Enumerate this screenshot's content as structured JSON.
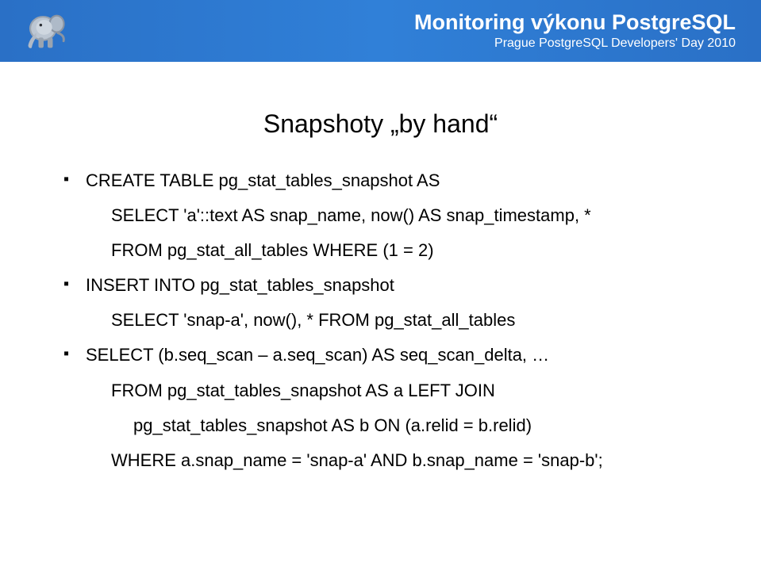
{
  "header": {
    "title": "Monitoring výkonu PostgreSQL",
    "subtitle": "Prague PostgreSQL Developers' Day 2010"
  },
  "slide": {
    "title": "Snapshoty „by hand“",
    "bullets": [
      {
        "line": "CREATE TABLE pg_stat_tables_snapshot AS",
        "subs": [
          "SELECT 'a'::text AS snap_name, now() AS snap_timestamp, *",
          "FROM pg_stat_all_tables WHERE (1 = 2)"
        ]
      },
      {
        "line": "INSERT INTO pg_stat_tables_snapshot",
        "subs": [
          "SELECT 'snap-a', now(), * FROM pg_stat_all_tables"
        ]
      },
      {
        "line": "SELECT (b.seq_scan – a.seq_scan) AS seq_scan_delta, …",
        "subs": [
          "FROM pg_stat_tables_snapshot AS a LEFT JOIN",
          "pg_stat_tables_snapshot AS b ON (a.relid = b.relid)",
          "WHERE a.snap_name = 'snap-a' AND b.snap_name = 'snap-b';"
        ]
      }
    ]
  }
}
